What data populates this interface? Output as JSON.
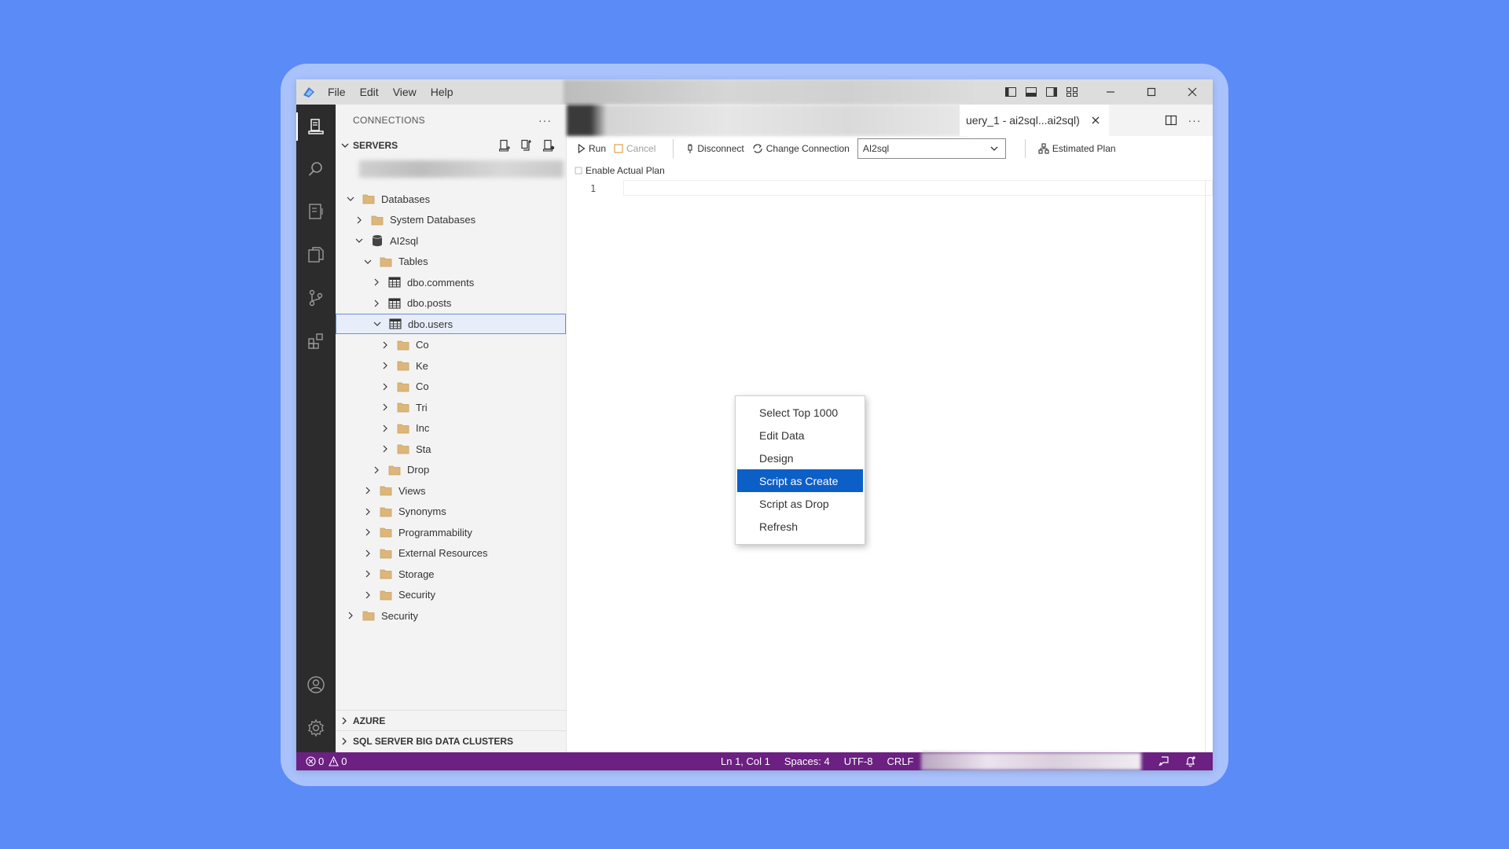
{
  "menu": [
    "File",
    "Edit",
    "View",
    "Help"
  ],
  "sidebar": {
    "header": "CONNECTIONS",
    "more": "···",
    "servers_label": "SERVERS",
    "tree": [
      {
        "label": "Databases",
        "icon": "folder-icon",
        "expanded": true
      },
      {
        "label": "System Databases",
        "icon": "folder-icon",
        "expanded": false
      },
      {
        "label": "AI2sql",
        "icon": "database-icon",
        "expanded": true
      },
      {
        "label": "Tables",
        "icon": "folder-icon",
        "expanded": true
      },
      {
        "label": "dbo.comments",
        "icon": "table-icon",
        "expanded": false
      },
      {
        "label": "dbo.posts",
        "icon": "table-icon",
        "expanded": false
      },
      {
        "label": "dbo.users",
        "icon": "table-icon",
        "expanded": true,
        "selected": true
      },
      {
        "label": "Co",
        "icon": "folder-icon",
        "expanded": false
      },
      {
        "label": "Ke",
        "icon": "folder-icon",
        "expanded": false
      },
      {
        "label": "Co",
        "icon": "folder-icon",
        "expanded": false
      },
      {
        "label": "Tri",
        "icon": "folder-icon",
        "expanded": false
      },
      {
        "label": "Inc",
        "icon": "folder-icon",
        "expanded": false
      },
      {
        "label": "Sta",
        "icon": "folder-icon",
        "expanded": false
      },
      {
        "label": "Drop",
        "icon": "folder-icon",
        "expanded": false
      },
      {
        "label": "Views",
        "icon": "folder-icon",
        "expanded": false
      },
      {
        "label": "Synonyms",
        "icon": "folder-icon",
        "expanded": false
      },
      {
        "label": "Programmability",
        "icon": "folder-icon",
        "expanded": false
      },
      {
        "label": "External Resources",
        "icon": "folder-icon",
        "expanded": false
      },
      {
        "label": "Storage",
        "icon": "folder-icon",
        "expanded": false
      },
      {
        "label": "Security",
        "icon": "folder-icon",
        "expanded": false
      },
      {
        "label": "Security",
        "icon": "folder-icon",
        "expanded": false
      }
    ],
    "azure_label": "AZURE",
    "bdc_label": "SQL SERVER BIG DATA CLUSTERS"
  },
  "editor": {
    "tab_title": "uery_1 - ai2sql...ai2sql)",
    "toolbar": {
      "run": "Run",
      "cancel": "Cancel",
      "disconnect": "Disconnect",
      "change_connection": "Change Connection",
      "database": "AI2sql",
      "estimated_plan": "Estimated Plan",
      "enable_actual_plan": "Enable Actual Plan"
    },
    "line_number": "1"
  },
  "context_menu": {
    "items": [
      "Select Top 1000",
      "Edit Data",
      "Design",
      "Script as Create",
      "Script as Drop",
      "Refresh"
    ],
    "highlighted": "Script as Create"
  },
  "status": {
    "errors": "0",
    "warnings": "0",
    "position": "Ln 1, Col 1",
    "spaces": "Spaces: 4",
    "encoding": "UTF-8",
    "eol": "CRLF"
  },
  "colors": {
    "background": "#5b8bf7",
    "status_bar": "#6b2082",
    "activity_bar": "#2c2c2c",
    "highlight": "#0d5fc8"
  }
}
